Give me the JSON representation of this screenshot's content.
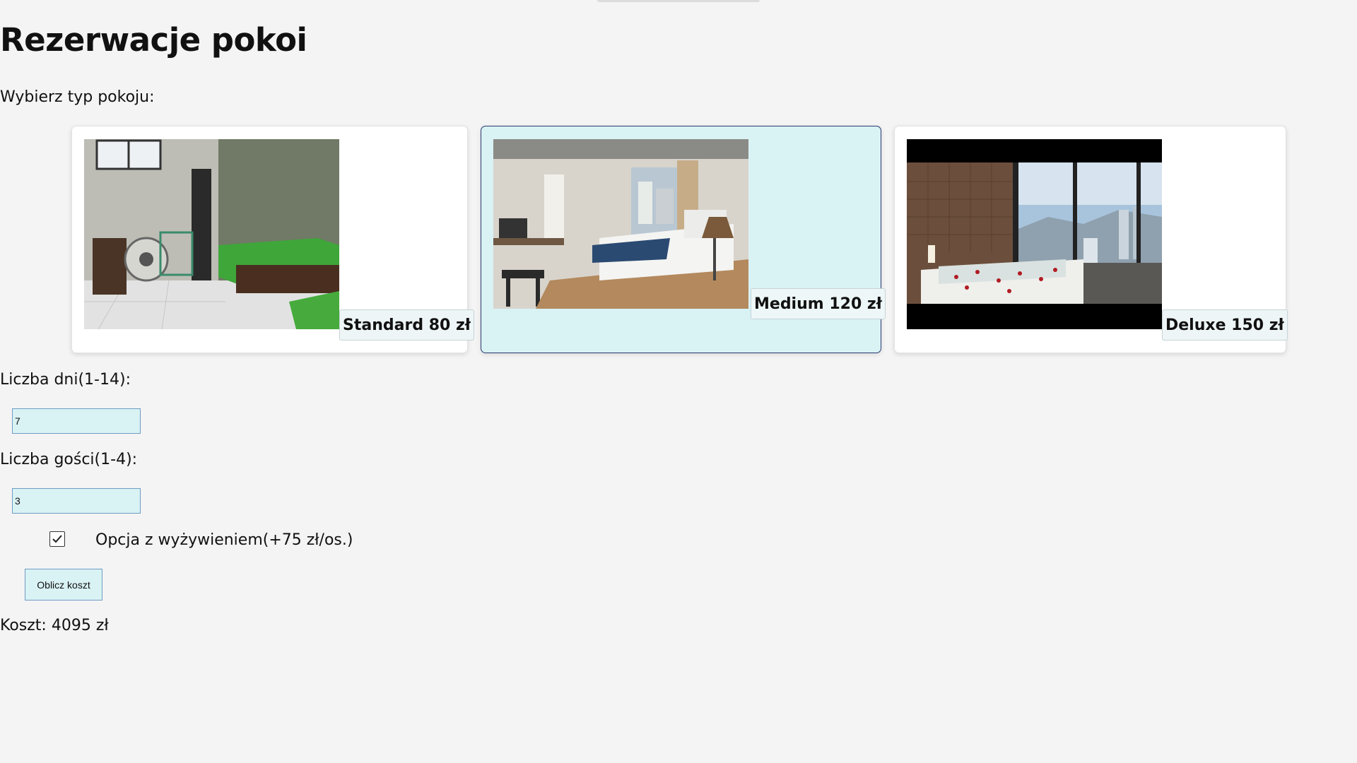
{
  "page": {
    "title": "Rezerwacje pokoi",
    "room_prompt": "Wybierz typ pokoju:"
  },
  "rooms": [
    {
      "id": "standard",
      "price_label": "Standard 80 zł",
      "image": "standard-room-photo",
      "selected": false
    },
    {
      "id": "medium",
      "price_label": "Medium 120 zł",
      "image": "medium-room-photo",
      "selected": true
    },
    {
      "id": "deluxe",
      "price_label": "Deluxe 150 zł",
      "image": "deluxe-room-photo",
      "selected": false
    }
  ],
  "form": {
    "days_label": "Liczba dni(1-14):",
    "days_value": "7",
    "guests_label": "Liczba gości(1-4):",
    "guests_value": "3",
    "meal_option_label": "Opcja z wyżywieniem(+75 zł/os.)",
    "meal_option_checked": true,
    "calculate_button": "Oblicz koszt"
  },
  "result": {
    "cost_text": "Koszt: 4095 zł"
  },
  "colors": {
    "selected_card": "#d9f2f4",
    "selected_border": "#2b3b73",
    "input_bg": "#d9f2f4",
    "input_border": "#6f9cc4"
  }
}
